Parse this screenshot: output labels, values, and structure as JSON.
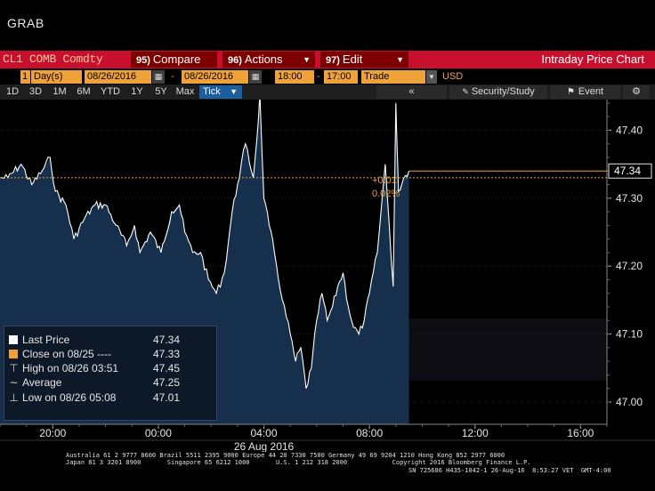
{
  "window": {
    "title": "GRAB"
  },
  "command_bar": {
    "ticker": "CL1 COMB Comdty",
    "compare": {
      "num": "95)",
      "label": "Compare"
    },
    "actions": {
      "num": "96)",
      "label": "Actions"
    },
    "edit": {
      "num": "97)",
      "label": "Edit"
    },
    "title": "Intraday Price Chart"
  },
  "params": {
    "period_count": "1",
    "period_unit": "Day(s)",
    "start_date": "08/26/2016",
    "separator": "-",
    "end_date": "08/26/2016",
    "start_time": "18:00",
    "time_separator": "-",
    "end_time": "17:00",
    "field": "Trade",
    "currency": "USD"
  },
  "range_buttons": [
    "1D",
    "3D",
    "1M",
    "6M",
    "YTD",
    "1Y",
    "5Y",
    "Max"
  ],
  "tick_button": "Tick",
  "toolbar": {
    "back_label": "«",
    "security_study": "Security/Study",
    "event": "Event"
  },
  "legend": {
    "last_price": {
      "label": "Last Price",
      "value": "47.34"
    },
    "close": {
      "label": "Close on 08/25  ----",
      "value": "47.33"
    },
    "high": {
      "label": "High on 08/26 03:51",
      "value": "47.45"
    },
    "average": {
      "label": "Average",
      "value": "47.25"
    },
    "low": {
      "label": "Low on 08/26 05:08",
      "value": "47.01"
    }
  },
  "price_annotations": {
    "change": "+0.01",
    "change_pct": "0.02%",
    "last_price_tag": "47.34"
  },
  "colors": {
    "accent_red": "#c8102e",
    "orange": "#f0a23a",
    "area_fill": "#163150",
    "price_line": "#ffffff"
  },
  "chart_data": {
    "type": "area",
    "x_axis_label": "26 Aug 2016",
    "x_ticks": [
      "20:00",
      "00:00",
      "04:00",
      "08:00",
      "12:00",
      "16:00"
    ],
    "y_ticks": [
      "47.40",
      "47.30",
      "47.20",
      "47.10",
      "47.00"
    ],
    "ylim": [
      46.97,
      47.51
    ],
    "xlim_hours": [
      18,
      41
    ],
    "close_line": 47.33,
    "last_price": 47.34,
    "series": [
      {
        "x": [
          18.0,
          18.3,
          18.8,
          19.2,
          19.6,
          19.9,
          20.1,
          20.5,
          20.8,
          21.2,
          21.6,
          22.0,
          22.4,
          22.8,
          23.1,
          23.3,
          23.7,
          24.1,
          24.5,
          24.8,
          25.0,
          25.3,
          25.6,
          25.9,
          26.2,
          26.5,
          26.8,
          27.0,
          27.3,
          27.6,
          27.8,
          27.85,
          28.0,
          28.2,
          28.4,
          28.7,
          29.0,
          29.2,
          29.4,
          29.6,
          29.8,
          30.0,
          30.2,
          30.4,
          30.6,
          30.8,
          31.0,
          31.2,
          31.4,
          31.6,
          31.8,
          32.0,
          32.3,
          32.6,
          32.75,
          32.9,
          33.0,
          33.05,
          33.1,
          33.3,
          33.5
        ],
        "y": [
          47.33,
          47.33,
          47.35,
          47.32,
          47.34,
          47.36,
          47.31,
          47.29,
          47.24,
          47.27,
          47.29,
          47.29,
          47.26,
          47.23,
          47.26,
          47.22,
          47.25,
          47.22,
          47.28,
          47.29,
          47.25,
          47.22,
          47.22,
          47.18,
          47.16,
          47.19,
          47.28,
          47.32,
          47.38,
          47.33,
          47.42,
          47.45,
          47.3,
          47.26,
          47.22,
          47.15,
          47.1,
          47.06,
          47.08,
          47.02,
          47.05,
          47.12,
          47.16,
          47.12,
          47.14,
          47.17,
          47.19,
          47.14,
          47.11,
          47.1,
          47.12,
          47.16,
          47.22,
          47.35,
          47.26,
          47.17,
          47.44,
          47.37,
          47.31,
          47.33,
          47.34
        ]
      }
    ]
  },
  "footer": {
    "line1": "Australia 61 2 9777 8600 Brazil 5511 2395 9000 Europe 44 20 7330 7500 Germany 49 69 9204 1210 Hong Kong 852 2977 6000",
    "line2": "Japan 81 3 3201 8900       Singapore 65 6212 1000       U.S. 1 212 318 2000            Copyright 2016 Bloomberg Finance L.P.",
    "line3": "SN 725686 H435-1042-1 26-Aug-16  8:53:27 VET  GMT-4:00"
  }
}
